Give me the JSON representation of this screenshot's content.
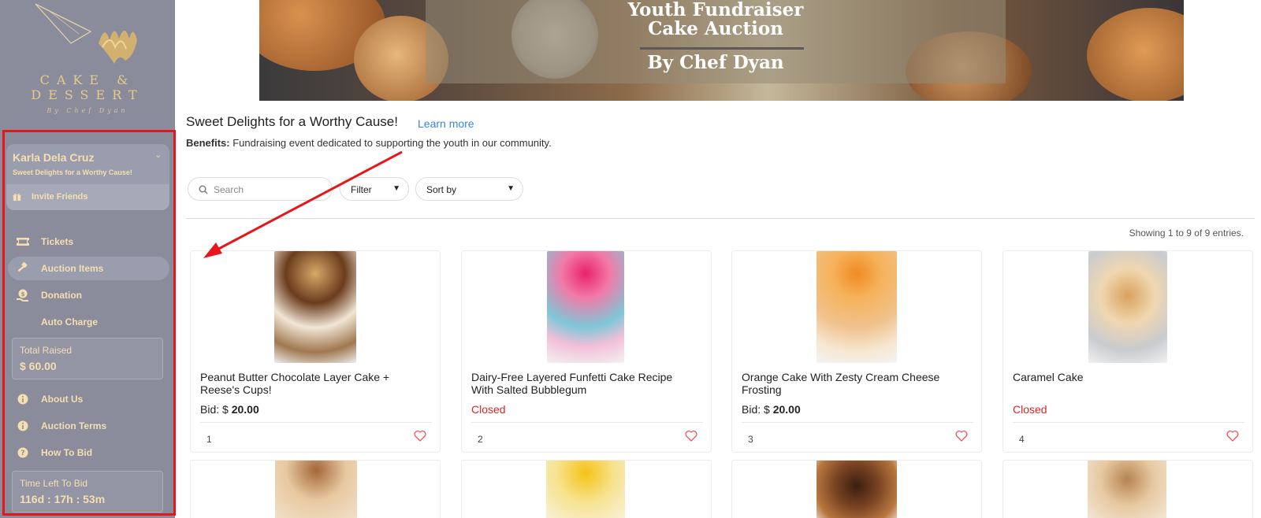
{
  "logo": {
    "line1": "CAKE &",
    "line2": "DESSERT",
    "tagline": "By Chef Dyan"
  },
  "banner": {
    "title_line1": "Youth Fundraiser",
    "title_line2": "Cake Auction",
    "byline": "By Chef Dyan"
  },
  "user": {
    "name": "Karla Dela Cruz",
    "subtitle": "Sweet Delights for a Worthy Cause!",
    "invite_label": "Invite Friends",
    "chevron_icon": "chevron-down-icon"
  },
  "nav": {
    "tickets": "Tickets",
    "auction_items": "Auction Items",
    "donation": "Donation",
    "auto_charge": "Auto Charge",
    "about_us": "About Us",
    "auction_terms": "Auction Terms",
    "how_to_bid": "How To Bid",
    "active": "Auction Items"
  },
  "stats": {
    "total_raised_label": "Total Raised",
    "total_raised_value": "$ 60.00",
    "time_left_label": "Time Left To Bid",
    "time_left_value": "116d : 17h : 53m"
  },
  "main": {
    "heading": "Sweet Delights for a Worthy Cause!",
    "learn_more": "Learn more",
    "benefits_label": "Benefits:",
    "benefits_text": " Fundraising event dedicated to supporting the youth in our community.",
    "search_placeholder": "Search",
    "filter_label": "Filter",
    "sort_label": "Sort by",
    "entries_text": "Showing 1 to 9 of 9 entries."
  },
  "items": [
    {
      "title_line1": "Peanut Butter Chocolate Layer Cake +",
      "title_line2": "Reese's Cups!",
      "status": "bid",
      "bid_prefix": "Bid: $ ",
      "bid_amount": "20.00",
      "number": "1"
    },
    {
      "title_line1": "Dairy-Free Layered Funfetti Cake Recipe",
      "title_line2": "With Salted Bubblegum",
      "status": "closed",
      "closed_label": "Closed",
      "number": "2"
    },
    {
      "title_line1": "Orange Cake With Zesty Cream Cheese",
      "title_line2": "Frosting",
      "status": "bid",
      "bid_prefix": "Bid: $ ",
      "bid_amount": "20.00",
      "number": "3"
    },
    {
      "title_line1": "Caramel Cake",
      "title_line2": "",
      "status": "closed",
      "closed_label": "Closed",
      "number": "4"
    }
  ],
  "colors": {
    "sidebar_bg": "#8a8c9c",
    "sidebar_text": "#f5deb0",
    "highlight": "#e8161a",
    "link": "#3a86e0",
    "closed": "#e02424",
    "heart": "#f2545b"
  }
}
